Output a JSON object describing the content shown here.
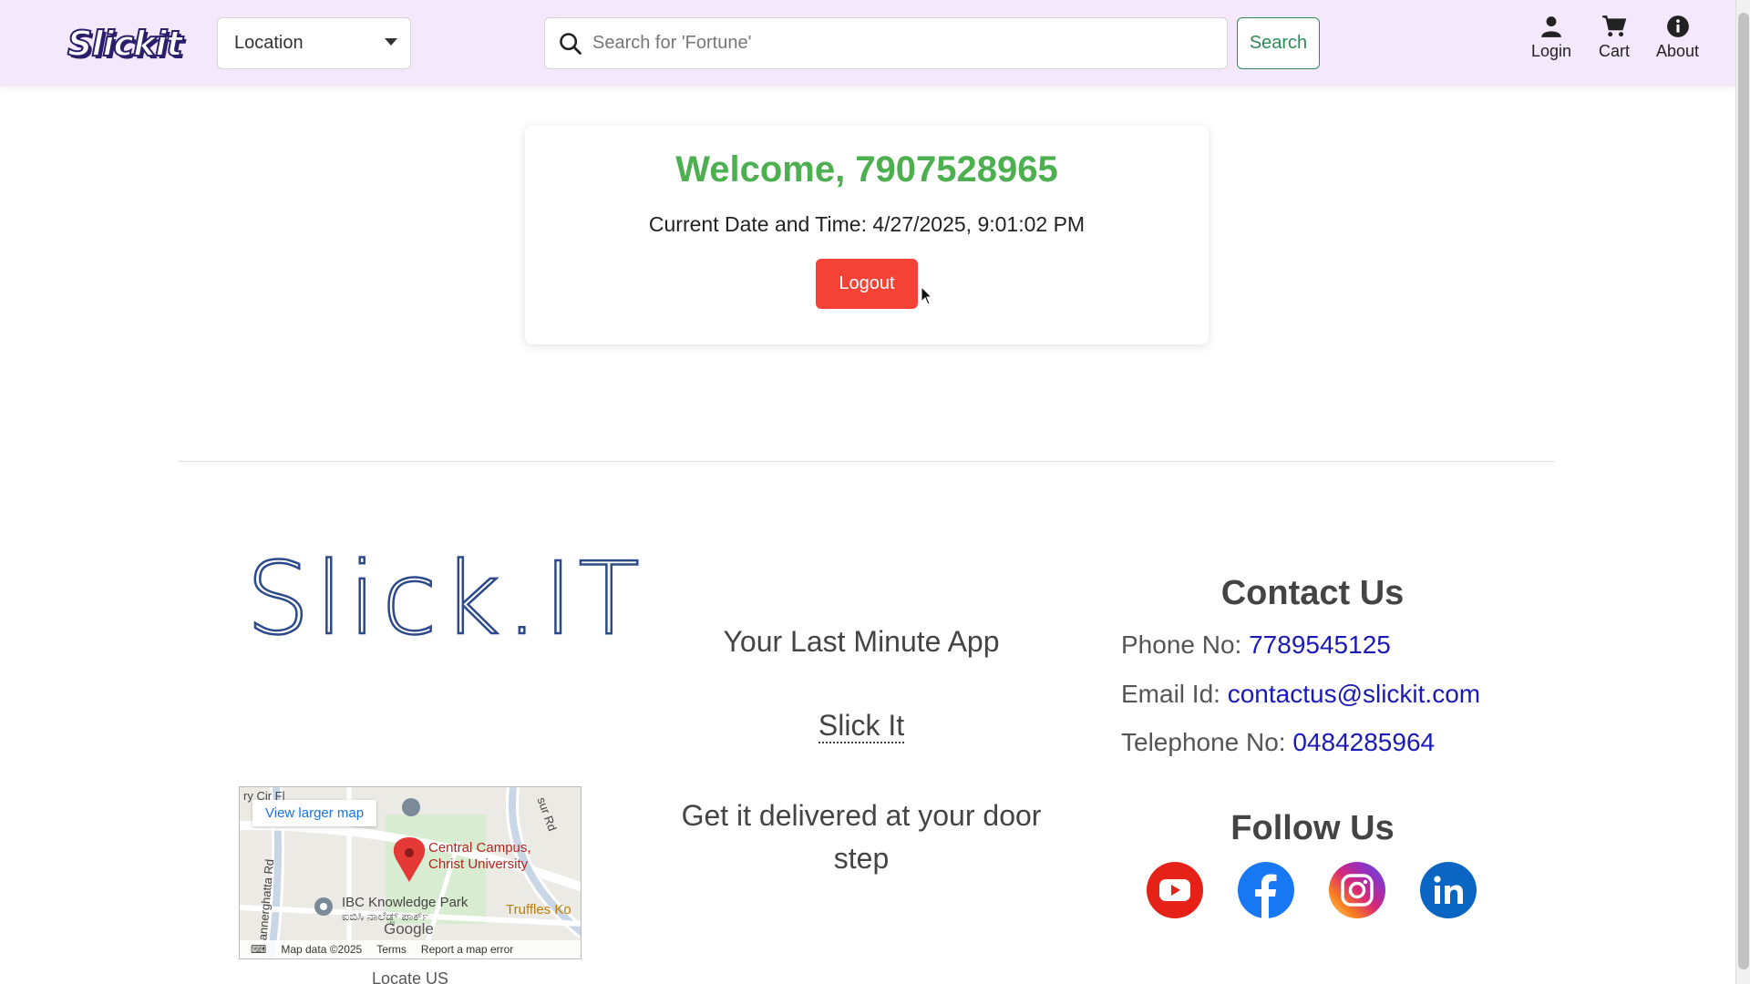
{
  "header": {
    "logo": "Slickit",
    "location_label": "Location",
    "search_placeholder": "Search for 'Fortune'",
    "search_button": "Search",
    "nav": {
      "login": "Login",
      "cart": "Cart",
      "about": "About"
    }
  },
  "welcome_card": {
    "title": "Welcome, 7907528965",
    "datetime": "Current Date and Time: 4/27/2025, 9:01:02 PM",
    "logout": "Logout"
  },
  "footer": {
    "brand": "Slick.IT",
    "tagline": "Your Last Minute App",
    "slickit_link": "Slick It",
    "delivered": "Get it delivered at your door step",
    "contact": {
      "title": "Contact Us",
      "phone_label": "Phone No:",
      "phone_value": "7789545125",
      "email_label": "Email Id:",
      "email_value": "contactus@slickit.com",
      "tel_label": "Telephone No:",
      "tel_value": "0484285964"
    },
    "follow": {
      "title": "Follow Us",
      "icons": [
        "youtube-icon",
        "facebook-icon",
        "instagram-icon",
        "linkedin-icon"
      ]
    },
    "map": {
      "view_larger": "View larger map",
      "place1_line1": "Central Campus,",
      "place1_line2": "Christ University",
      "place2_line1": "IBC Knowledge Park",
      "place2_line2": "ಐಬಿಸಿ ನಾಲೆಡ್ಜ್ ಪಾರ್ಕ್",
      "place3": "Truffles Ko",
      "road1": "annerghatta Rd",
      "road2": "sur Rd",
      "road3": "ry Cir Fl",
      "google": "Google",
      "map_data": "Map data ©2025",
      "terms": "Terms",
      "report": "Report a map error"
    },
    "locate": "Locate US"
  },
  "colors": {
    "header_bg": "#f3e8fc",
    "welcome_green": "#4caf50",
    "logout_red": "#f44336",
    "link_blue": "#1a1ab8",
    "search_green": "#2e8b57"
  }
}
